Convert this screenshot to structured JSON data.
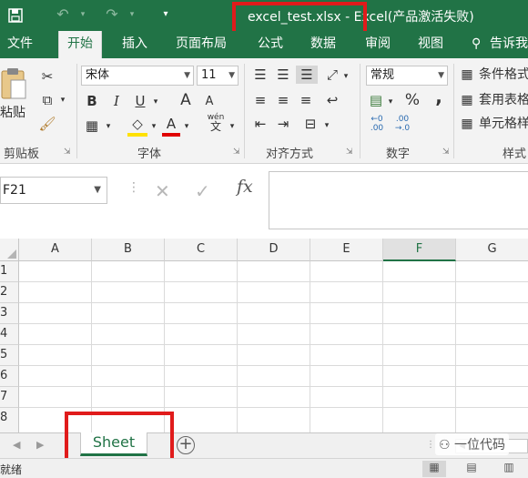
{
  "titlebar": {
    "title": "excel_test.xlsx - Excel(产品激活失败)",
    "save_icon": "save-icon",
    "undo_icon": "undo-icon",
    "redo_icon": "redo-icon",
    "customize_icon": "customize-quick-access-icon",
    "colors": {
      "background": "#217346",
      "highlight": "#e01b1b"
    }
  },
  "tabs": [
    {
      "label": "文件"
    },
    {
      "label": "开始"
    },
    {
      "label": "插入"
    },
    {
      "label": "页面布局"
    },
    {
      "label": "公式"
    },
    {
      "label": "数据"
    },
    {
      "label": "审阅"
    },
    {
      "label": "视图"
    },
    {
      "label": "告诉我"
    }
  ],
  "ribbon": {
    "clipboard": {
      "paste": "粘贴",
      "label": "剪贴板"
    },
    "font": {
      "name": "宋体",
      "size": "11",
      "bold": "B",
      "italic": "I",
      "underline": "U",
      "grow": "A",
      "shrink": "A",
      "font_color": "A",
      "phonetic_top": "wén",
      "phonetic_bottom": "文",
      "label": "字体"
    },
    "alignment": {
      "label": "对齐方式"
    },
    "number": {
      "format": "常规",
      "percent": "%",
      "comma": ",",
      "label": "数字",
      "dec_inc_top": "←0",
      "dec_inc_bottom": ".00",
      "dec_dec_top": ".00",
      "dec_dec_bottom": "→.0"
    },
    "styles": {
      "conditional": "条件格式",
      "table": "套用表格",
      "cell": "单元格样",
      "label": "样式"
    }
  },
  "formula_bar": {
    "name_box": "F21",
    "cancel": "✕",
    "confirm": "✓",
    "fx": "fx",
    "value": ""
  },
  "grid": {
    "columns": [
      "A",
      "B",
      "C",
      "D",
      "E",
      "F",
      "G"
    ],
    "selected_column": "F",
    "rows": [
      "1",
      "2",
      "3",
      "4",
      "5",
      "6",
      "7",
      "8"
    ]
  },
  "sheets": {
    "tabs": [
      "Sheet"
    ],
    "add": "+"
  },
  "status": {
    "ready": "就绪"
  },
  "watermark": "一位代码"
}
